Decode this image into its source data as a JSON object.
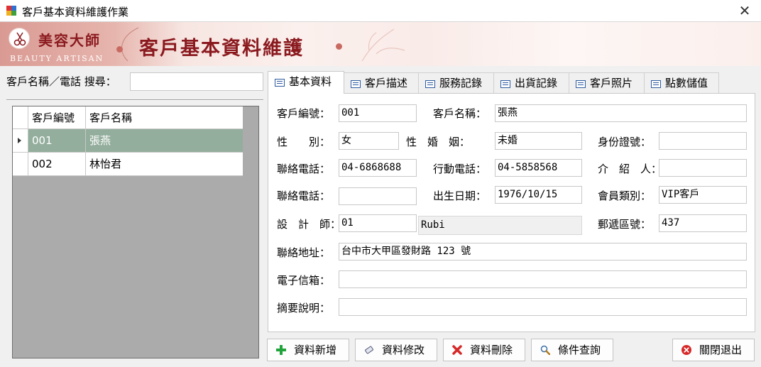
{
  "window": {
    "title": "客戶基本資料維護作業",
    "close_icon": "✕"
  },
  "banner": {
    "logo_text_cn": "美容大師",
    "logo_text_en": "BEAUTY ARTISAN",
    "title": "客戶基本資料維護"
  },
  "search": {
    "label": "客戶名稱／電話 搜尋：",
    "value": ""
  },
  "customer_grid": {
    "columns": [
      "客戶編號",
      "客戶名稱"
    ],
    "rows": [
      {
        "id": "001",
        "name": "張燕",
        "selected": true
      },
      {
        "id": "002",
        "name": "林怡君",
        "selected": false
      }
    ]
  },
  "tabs": [
    {
      "label": "基本資料",
      "active": true
    },
    {
      "label": "客戶描述",
      "active": false
    },
    {
      "label": "服務記錄",
      "active": false
    },
    {
      "label": "出貨記錄",
      "active": false
    },
    {
      "label": "客戶照片",
      "active": false
    },
    {
      "label": "點數儲值",
      "active": false
    }
  ],
  "form": {
    "customer_no": {
      "label": "客戶編號：",
      "value": "001"
    },
    "customer_name": {
      "label": "客戶名稱：",
      "value": "張燕"
    },
    "gender": {
      "label": "性　　別：",
      "value": "女"
    },
    "marital": {
      "label": "性　婚　姻：",
      "value": "未婚"
    },
    "id_no": {
      "label": "身份證號：",
      "value": ""
    },
    "phone": {
      "label": "聯絡電話：",
      "value": "04-6868688"
    },
    "mobile": {
      "label": "行動電話：",
      "value": "04-5858568"
    },
    "referrer": {
      "label": "介　紹　人：",
      "value": ""
    },
    "phone2": {
      "label": "聯絡電話：",
      "value": ""
    },
    "birthday": {
      "label": "出生日期：",
      "value": "1976/10/15"
    },
    "member_type": {
      "label": "會員類別：",
      "value": "VIP客戶"
    },
    "designer": {
      "label": "設　計　師：",
      "value": "01",
      "name_value": "Rubi"
    },
    "zip": {
      "label": "郵遞區號：",
      "value": "437"
    },
    "address": {
      "label": "聯絡地址：",
      "value": "台中市大甲區發財路 123 號"
    },
    "email": {
      "label": "電子信箱：",
      "value": ""
    },
    "note": {
      "label": "摘要說明：",
      "value": ""
    }
  },
  "buttons": {
    "add": "資料新增",
    "edit": "資料修改",
    "delete": "資料刪除",
    "query": "條件查詢",
    "exit": "關閉退出"
  },
  "colors": {
    "selected_row": "#93ae9c",
    "banner_text": "#8b1a1f",
    "add_icon": "#1fa33a",
    "delete_icon": "#d62828"
  }
}
